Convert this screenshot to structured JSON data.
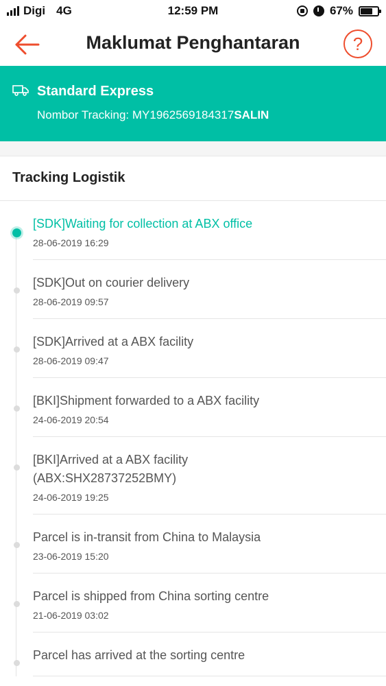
{
  "status_bar": {
    "carrier": "Digi",
    "network": "4G",
    "time": "12:59 PM",
    "battery": "67%",
    "battery_level": 0.67
  },
  "header": {
    "title": "Maklumat Penghantaran",
    "help_label": "?"
  },
  "shipping": {
    "service": "Standard Express",
    "tracking_label": "Nombor Tracking: ",
    "tracking_number": "MY1962569184317",
    "copy_label": "SALIN"
  },
  "logistics": {
    "title": "Tracking Logistik",
    "events": [
      {
        "status": "[SDK]Waiting for collection at ABX office",
        "time": "28-06-2019 16:29"
      },
      {
        "status": "[SDK]Out on courier delivery",
        "time": "28-06-2019 09:57"
      },
      {
        "status": "[SDK]Arrived at a ABX facility",
        "time": "28-06-2019 09:47"
      },
      {
        "status": "[BKI]Shipment forwarded to a ABX facility",
        "time": "24-06-2019 20:54"
      },
      {
        "status": "[BKI]Arrived at a ABX facility\n(ABX:SHX28737252BMY)",
        "time": "24-06-2019 19:25"
      },
      {
        "status": "Parcel is in-transit from China to Malaysia",
        "time": "23-06-2019 15:20"
      },
      {
        "status": "Parcel is shipped from China sorting centre",
        "time": "21-06-2019 03:02"
      },
      {
        "status": "Parcel has arrived at the sorting centre",
        "time": ""
      }
    ]
  },
  "colors": {
    "accent": "#00bfa5",
    "brand": "#ee4d2d"
  }
}
